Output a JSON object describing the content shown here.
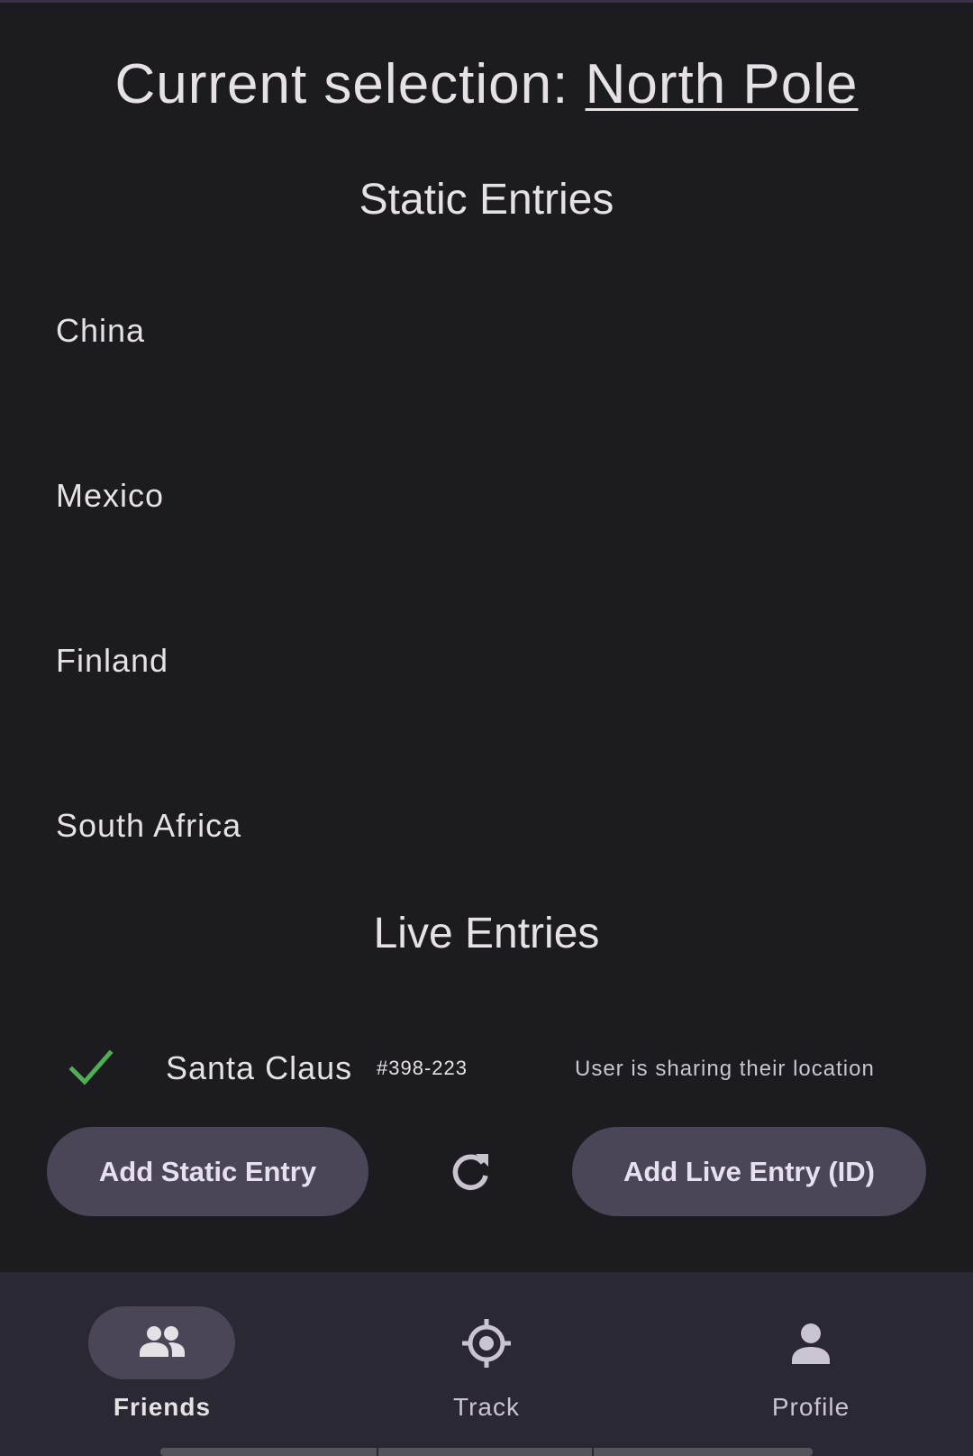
{
  "header": {
    "selection_prefix": "Current selection: ",
    "selection_value": "North Pole"
  },
  "static_section": {
    "title": "Static Entries",
    "items": [
      "China",
      "Mexico",
      "Finland",
      "South Africa"
    ]
  },
  "live_section": {
    "title": "Live Entries",
    "entries": [
      {
        "name": "Santa Claus",
        "id": "#398-223",
        "status": "User is sharing their location",
        "icon": "check-icon",
        "icon_color": "#4caf50"
      }
    ]
  },
  "actions": {
    "add_static_label": "Add Static Entry",
    "refresh_icon": "refresh-icon",
    "add_live_label": "Add Live Entry (ID)"
  },
  "bottom_nav": {
    "items": [
      {
        "label": "Friends",
        "icon": "friends-icon",
        "selected": true
      },
      {
        "label": "Track",
        "icon": "target-icon",
        "selected": false
      },
      {
        "label": "Profile",
        "icon": "person-icon",
        "selected": false
      }
    ]
  },
  "colors": {
    "background": "#1c1b20",
    "button": "#4a4658",
    "nav_background": "#2a2832",
    "check": "#4caf50"
  }
}
